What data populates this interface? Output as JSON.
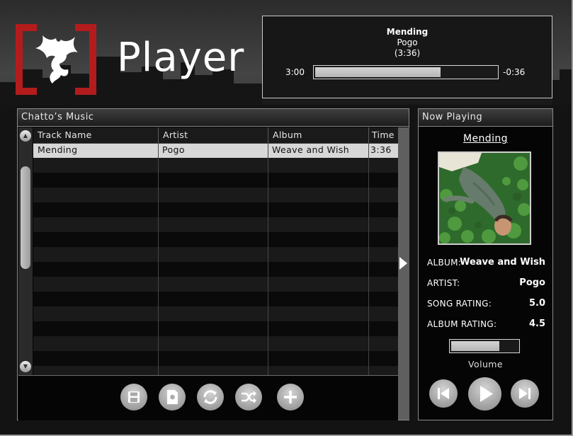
{
  "app": {
    "logo_text": "Player"
  },
  "now_box": {
    "title": "Mending",
    "artist": "Pogo",
    "duration": "(3:36)",
    "elapsed": "3:00",
    "remaining": "-0:36",
    "progress_fraction": 0.69
  },
  "library": {
    "title": "Chatto’s Music",
    "columns": [
      "Track Name",
      "Artist",
      "Album",
      "Time"
    ],
    "rows": [
      {
        "track": "Mending",
        "artist": "Pogo",
        "album": "Weave and Wish",
        "time": "3:36"
      }
    ],
    "toolbar_icons": [
      "save-icon",
      "new-playlist-icon",
      "repeat-icon",
      "shuffle-icon",
      "add-icon"
    ]
  },
  "now_playing": {
    "title": "Now Playing",
    "song": "Mending",
    "album_label": "ALBUM:",
    "album": "Weave and Wish",
    "artist_label": "ARTIST:",
    "artist": "Pogo",
    "song_rating_label": "SONG RATING:",
    "song_rating": "5.0",
    "album_rating_label": "ALBUM RATING:",
    "album_rating": "4.5",
    "volume_label": "Volume",
    "volume_fraction": 0.72
  },
  "colors": {
    "logo_accent": "#b31c1c",
    "background": "#131313"
  }
}
